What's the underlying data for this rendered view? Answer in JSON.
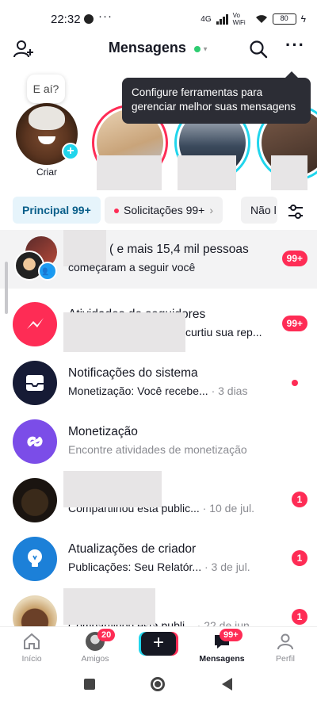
{
  "status_bar": {
    "time": "22:32",
    "more": "···",
    "network": "4G",
    "wifi_label": "Vo WiFi",
    "battery": "80"
  },
  "header": {
    "title": "Mensagens",
    "status_color": "#2ecc71",
    "add_friend_icon": "person-plus-icon",
    "search_icon": "search-icon",
    "more_icon": "more-horizontal-icon"
  },
  "tooltip": {
    "text": "Configure ferramentas para gerenciar melhor suas mensagens"
  },
  "stories": {
    "bubble_text": "E aí?",
    "create_label": "Criar",
    "items": [
      {
        "ring": "#fe2c55"
      },
      {
        "ring": "#20d5ec"
      },
      {
        "ring": "#20d5ec"
      }
    ]
  },
  "tabs": [
    {
      "label": "Principal 99+",
      "active": true
    },
    {
      "label": "Solicitações 99+",
      "dot": true
    },
    {
      "label": "Não l"
    }
  ],
  "filter_icon": "sliders-icon",
  "conversations": [
    {
      "title": "( e mais 15,4 mil pessoas",
      "subtitle": "começaram a seguir você",
      "badge": "99+",
      "avatar": "group-avatar"
    },
    {
      "title": "Atividades de seguidores",
      "subtitle": "curtiu sua rep...",
      "badge": "99+",
      "avatar": "lightning-icon"
    },
    {
      "title": "Notificações do sistema",
      "subtitle": "Monetização: Você recebe...",
      "time": "· 3 dias",
      "indicator": "dot",
      "avatar": "inbox-icon"
    },
    {
      "title": "Monetização",
      "subtitle": "Encontre atividades de monetização",
      "avatar": "link-icon"
    },
    {
      "title": "",
      "subtitle": "Compartilhou esta public...",
      "time": "· 10 de jul.",
      "badge": "1",
      "avatar": "profile-photo"
    },
    {
      "title": "Atualizações de criador",
      "subtitle": "Publicações: Seu Relatór...",
      "time": "· 3 de jul.",
      "badge": "1",
      "avatar": "lightbulb-icon"
    },
    {
      "title": "",
      "subtitle": "Compartilhou esta publi...",
      "time": "· 22 de jun.",
      "badge": "1",
      "avatar": "profile-photo"
    }
  ],
  "bottom_nav": [
    {
      "label": "Início",
      "icon": "home-icon"
    },
    {
      "label": "Amigos",
      "icon": "friends-avatar",
      "badge": "20"
    },
    {
      "label": "",
      "icon": "plus-icon"
    },
    {
      "label": "Mensagens",
      "icon": "messages-icon",
      "badge": "99+",
      "active": true
    },
    {
      "label": "Perfil",
      "icon": "profile-icon"
    }
  ],
  "colors": {
    "accent_red": "#fe2c55",
    "accent_teal": "#20d5ec",
    "text": "#161823",
    "muted": "#8a8b91"
  }
}
